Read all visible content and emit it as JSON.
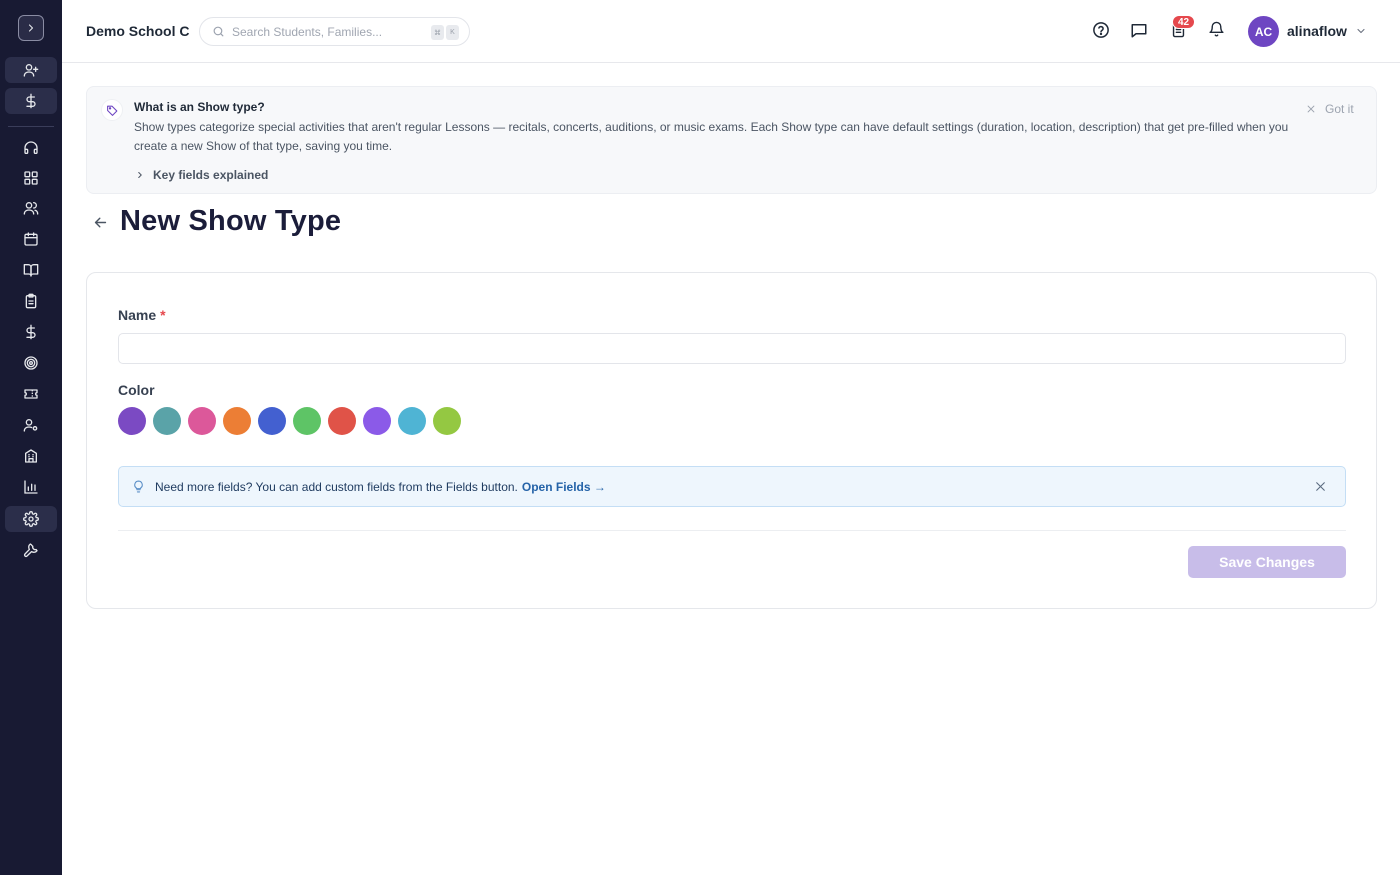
{
  "app": {
    "school_name": "Demo School C",
    "search_placeholder": "Search Students, Families...",
    "search_shortcut": [
      "⌘",
      "K"
    ],
    "notification_badge": "42",
    "user": {
      "initials": "AC",
      "name": "alinaflow",
      "avatar_color": "#6e46c2"
    }
  },
  "sidebar": {
    "items": [
      {
        "icon": "user-plus-icon"
      },
      {
        "icon": "dollar-icon"
      },
      {
        "icon": "headset-icon"
      },
      {
        "icon": "dashboard-grid-icon"
      },
      {
        "icon": "users-icon"
      },
      {
        "icon": "calendar-icon"
      },
      {
        "icon": "book-icon"
      },
      {
        "icon": "clipboard-icon"
      },
      {
        "icon": "dollar-icon"
      },
      {
        "icon": "target-icon"
      },
      {
        "icon": "ticket-icon"
      },
      {
        "icon": "user-settings-icon"
      },
      {
        "icon": "building-icon"
      },
      {
        "icon": "bar-chart-icon"
      },
      {
        "icon": "gear-icon"
      },
      {
        "icon": "wrench-icon"
      }
    ]
  },
  "info_panel": {
    "title": "What is an Show type?",
    "body": "Show types categorize special activities that aren't regular Lessons — recitals, concerts, auditions, or music exams. Each Show type can have default settings (duration, location, description) that get pre-filled when you create a new Show of that type, saving you time.",
    "key_fields_label": "Key fields explained",
    "dismiss_label": "Got it"
  },
  "page": {
    "title": "New Show Type"
  },
  "form": {
    "name_label": "Name",
    "required_marker": "*",
    "name_value": "",
    "color_label": "Color",
    "colors": [
      "#7b4ac3",
      "#5aa3a8",
      "#dc589a",
      "#ec7e35",
      "#4360d0",
      "#5ec466",
      "#e05348",
      "#8b5ae8",
      "#4fb4d4",
      "#94c842"
    ],
    "tip_text": "Need more fields? You can add custom fields from the Fields button.",
    "tip_link": "Open Fields →",
    "save_label": "Save Changes"
  }
}
